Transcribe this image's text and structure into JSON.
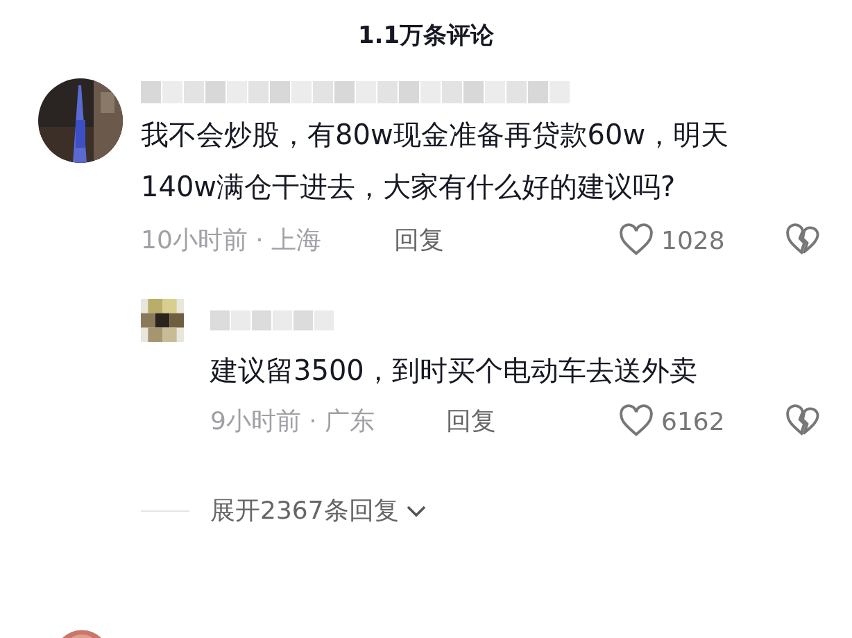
{
  "header": {
    "title": "1.1万条评论"
  },
  "comments": [
    {
      "text": "我不会炒股，有80w现金准备再贷款60w，明天140w满仓干进去，大家有什么好的建议吗?",
      "meta": "10小时前 · 上海",
      "reply_label": "回复",
      "likes": "1028",
      "replies": [
        {
          "text": "建议留3500，到时买个电动车去送外卖",
          "meta": "9小时前 · 广东",
          "reply_label": "回复",
          "likes": "6162"
        }
      ],
      "expand_label": "展开2367条回复"
    }
  ]
}
